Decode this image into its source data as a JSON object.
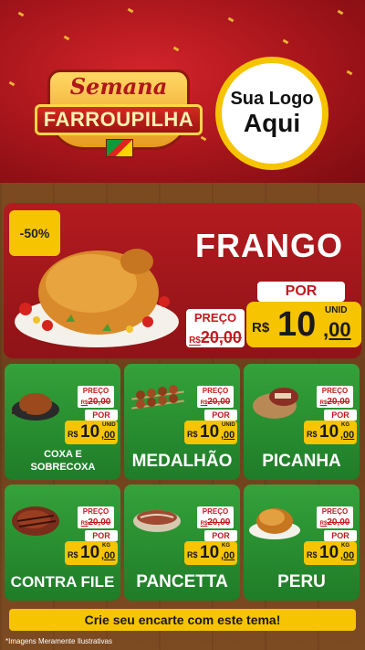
{
  "header": {
    "event_top": "Semana",
    "event_main": "FARROUPILHA",
    "logo_line1": "Sua Logo",
    "logo_line2": "Aqui"
  },
  "featured": {
    "discount": "-50%",
    "name": "FRANGO",
    "preco_label": "PREÇO",
    "old_currency": "R$",
    "old_price": "20,00",
    "por_label": "POR",
    "new_currency": "R$",
    "new_int": "10",
    "new_dec": ",00",
    "unit": "UNID"
  },
  "products": [
    {
      "name": "COXA E SOBRECOXA",
      "preco_label": "PREÇO",
      "old_currency": "R$",
      "old_price": "20,00",
      "por_label": "POR",
      "new_currency": "R$",
      "new_int": "10",
      "new_dec": ",00",
      "unit": "UNID"
    },
    {
      "name": "MEDALHÃO",
      "preco_label": "PREÇO",
      "old_currency": "R$",
      "old_price": "20,00",
      "por_label": "POR",
      "new_currency": "R$",
      "new_int": "10",
      "new_dec": ",00",
      "unit": "UNID"
    },
    {
      "name": "PICANHA",
      "preco_label": "PREÇO",
      "old_currency": "R$",
      "old_price": "20,00",
      "por_label": "POR",
      "new_currency": "R$",
      "new_int": "10",
      "new_dec": ",00",
      "unit": "KG"
    },
    {
      "name": "CONTRA FILE",
      "preco_label": "PREÇO",
      "old_currency": "R$",
      "old_price": "20,00",
      "por_label": "POR",
      "new_currency": "R$",
      "new_int": "10",
      "new_dec": ",00",
      "unit": "KG"
    },
    {
      "name": "PANCETTA",
      "preco_label": "PREÇO",
      "old_currency": "R$",
      "old_price": "20,00",
      "por_label": "POR",
      "new_currency": "R$",
      "new_int": "10",
      "new_dec": ",00",
      "unit": "KG"
    },
    {
      "name": "PERU",
      "preco_label": "PREÇO",
      "old_currency": "R$",
      "old_price": "20,00",
      "por_label": "POR",
      "new_currency": "R$",
      "new_int": "10",
      "new_dec": ",00",
      "unit": "KG"
    }
  ],
  "footer": {
    "cta": "Crie seu encarte com este tema!",
    "disclaimer": "*Imagens Meramente Ilustrativas"
  },
  "colors": {
    "header_red": "#b31b20",
    "card_green": "#2f9a35",
    "price_yellow": "#f6c400",
    "wood_brown": "#7a4a22"
  }
}
